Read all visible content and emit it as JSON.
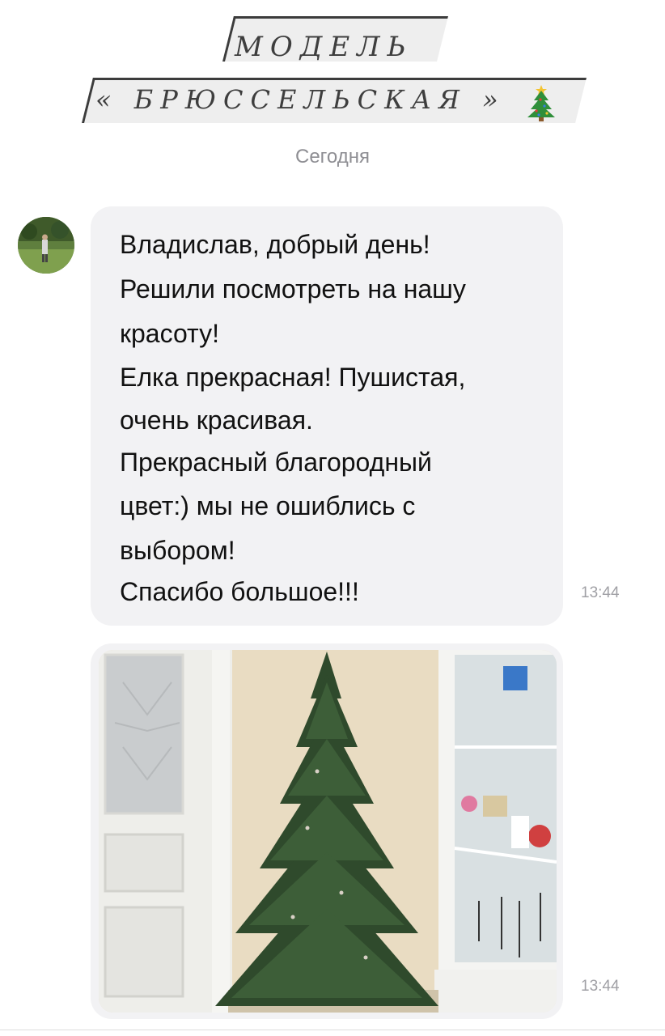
{
  "header": {
    "title_line1": "МОДЕЛЬ",
    "title_line2": "« БРЮССЕЛЬСКАЯ »",
    "emoji_icon": "christmas-tree-icon"
  },
  "chat": {
    "date_separator": "Сегодня",
    "message": {
      "lines": [
        "Владислав, добрый день!",
        "Решили посмотреть на нашу",
        "красоту!",
        "Елка прекрасная! Пушистая,",
        "очень красивая.",
        "Прекрасный благородный",
        "цвет:) мы не ошиблись с",
        "выбором!",
        "Спасибо большое!!!"
      ],
      "time": "13:44"
    },
    "photo_message": {
      "time": "13:44"
    }
  },
  "colors": {
    "bubble": "#f2f2f4",
    "title_text": "#3e3e3e",
    "meta_text": "#a0a0a5"
  }
}
